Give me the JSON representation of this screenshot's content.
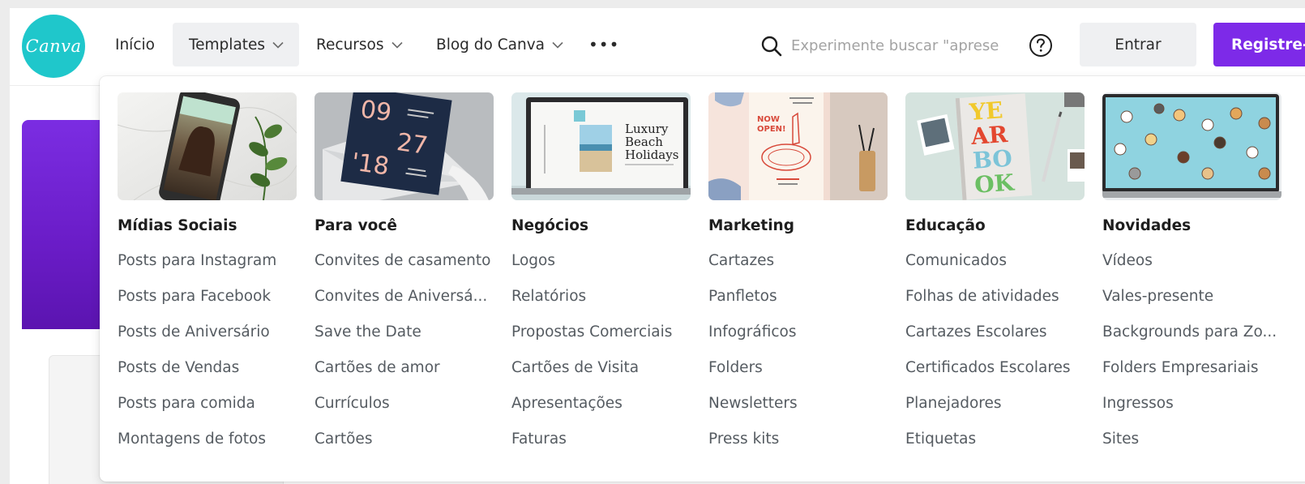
{
  "header": {
    "logo_text": "Canva",
    "nav": [
      {
        "label": "Início",
        "has_chevron": false
      },
      {
        "label": "Templates",
        "has_chevron": true,
        "active": true
      },
      {
        "label": "Recursos",
        "has_chevron": true
      },
      {
        "label": "Blog do Canva",
        "has_chevron": true
      }
    ],
    "more_label": "•••",
    "search_placeholder": "Experimente buscar \"apresentações\"",
    "entrar_label": "Entrar",
    "registrar_label": "Registre-se"
  },
  "dropdown": {
    "columns": [
      {
        "title": "Mídias Sociais",
        "thumb": "social-media-phone-thumbnail",
        "links": [
          "Posts para Instagram",
          "Posts para Facebook",
          "Posts de Aniversário",
          "Posts de Vendas",
          "Posts para comida",
          "Montagens de fotos"
        ]
      },
      {
        "title": "Para você",
        "thumb": "invitation-card-thumbnail",
        "thumb_text": {
          "line1": "09",
          "line2": "27",
          "line3": "'18"
        },
        "links": [
          "Convites de casamento",
          "Convites de Aniversá...",
          "Save the Date",
          "Cartões de amor",
          "Currículos",
          "Cartões"
        ]
      },
      {
        "title": "Negócios",
        "thumb": "laptop-presentation-thumbnail",
        "thumb_text": {
          "line1": "Luxury",
          "line2": "Beach",
          "line3": "Holidays"
        },
        "links": [
          "Logos",
          "Relatórios",
          "Propostas Comerciais",
          "Cartões de Visita",
          "Apresentações",
          "Faturas"
        ]
      },
      {
        "title": "Marketing",
        "thumb": "pizzeria-poster-thumbnail",
        "thumb_text": {
          "line1": "NOW",
          "line2": "OPEN!"
        },
        "links": [
          "Cartazes",
          "Panfletos",
          "Infográficos",
          "Folders",
          "Newsletters",
          "Press kits"
        ]
      },
      {
        "title": "Educação",
        "thumb": "yearbook-thumbnail",
        "thumb_text": {
          "line1": "YE",
          "line2": "AR",
          "line3": "BO",
          "line4": "OK"
        },
        "links": [
          "Comunicados",
          "Folhas de atividades",
          "Cartazes Escolares",
          "Certificados Escolares",
          "Planejadores",
          "Etiquetas"
        ]
      },
      {
        "title": "Novidades",
        "thumb": "laptop-dogs-pattern-thumbnail",
        "links": [
          "Vídeos",
          "Vales-presente",
          "Backgrounds para Zo...",
          "Folders Empresariais",
          "Ingressos",
          "Sites"
        ]
      }
    ]
  },
  "colors": {
    "brand_teal": "#1fc7cb",
    "brand_purple": "#7d2ae8",
    "nav_active_bg": "#eff0f2",
    "link_color": "#555b61"
  }
}
